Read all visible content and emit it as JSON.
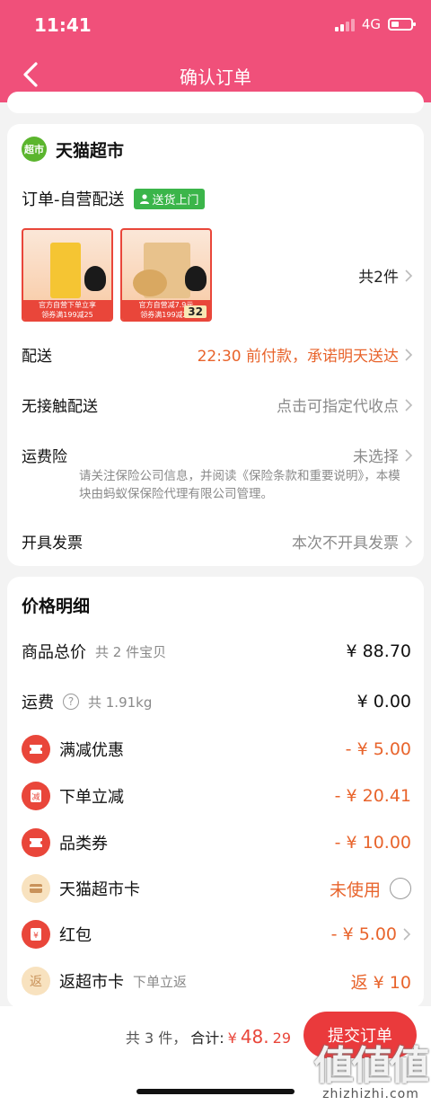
{
  "status_bar": {
    "time": "11:41",
    "network": "4G"
  },
  "header": {
    "title": "确认订单"
  },
  "store": {
    "logo_text": "超市",
    "name": "天猫超市"
  },
  "order": {
    "type": "订单-自营配送",
    "badge": "送货上门",
    "item_count": "共2件",
    "thumbnails": [
      {
        "label_top": "官方自营下单立享",
        "label_bottom": "领券满199减25",
        "num": ""
      },
      {
        "label_top": "官方自营减7.9元",
        "label_bottom": "领券满199减25",
        "num": "32"
      }
    ]
  },
  "rows": {
    "delivery": {
      "label": "配送",
      "value": "22:30 前付款，承诺明天送达"
    },
    "contactless": {
      "label": "无接触配送",
      "value": "点击可指定代收点"
    },
    "insurance": {
      "label": "运费险",
      "value": "未选择",
      "note": "请关注保险公司信息，并阅读《保险条款和重要说明》，本模块由蚂蚁保保险代理有限公司管理。"
    },
    "invoice": {
      "label": "开具发票",
      "value": "本次不开具发票"
    }
  },
  "price": {
    "title": "价格明细",
    "items": [
      {
        "label": "商品总价",
        "sub": "共 2 件宝贝",
        "value": "¥ 88.70"
      },
      {
        "label": "运费",
        "sub": "共 1.91kg",
        "value": "¥ 0.00"
      },
      {
        "label": "满减优惠",
        "value": "- ¥ 5.00"
      },
      {
        "label": "下单立减",
        "value": "- ¥ 20.41"
      },
      {
        "label": "品类券",
        "value": "- ¥ 10.00"
      },
      {
        "label": "天猫超市卡",
        "value": "未使用"
      },
      {
        "label": "红包",
        "value": "- ¥ 5.00"
      },
      {
        "label": "返超市卡",
        "sub": "下单立返",
        "value": "返 ¥ 10"
      }
    ]
  },
  "bottom": {
    "count": "共 3 件，",
    "total_label": "合计:",
    "currency": "¥",
    "total_int": "48.",
    "total_dec": "29",
    "submit_label": "提交订单"
  },
  "colors": {
    "header": "#f0507a",
    "accent_red": "#e9463a",
    "discount_orange": "#e8642c",
    "badge_green": "#3bb54a"
  }
}
